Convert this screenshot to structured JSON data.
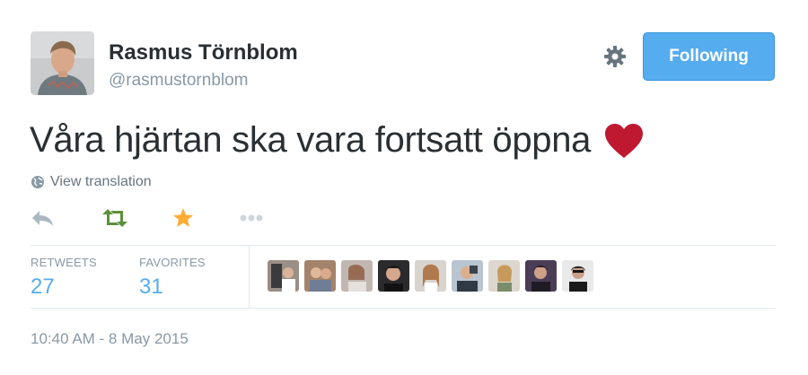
{
  "author": {
    "name": "Rasmus Törnblom",
    "handle": "@rasmustornblom"
  },
  "follow_button": {
    "label": "Following"
  },
  "tweet": {
    "text": "Våra hjärtan ska vara fortsatt öppna"
  },
  "translation": {
    "label": "View translation"
  },
  "actions": [
    {
      "icon": "reply-icon",
      "color": "#aab8c2"
    },
    {
      "icon": "retweet-icon",
      "color": "#5c913b"
    },
    {
      "icon": "favorite-star-icon",
      "color": "#ffac33"
    },
    {
      "icon": "more-dots-icon",
      "color": "#ccd6dd"
    }
  ],
  "stats": {
    "retweets_label": "RETWEETS",
    "retweets_count": "27",
    "favorites_label": "FAVORITES",
    "favorites_count": "31"
  },
  "favoriters_count_shown": 9,
  "timestamp": "10:40 AM - 8 May 2015",
  "colors": {
    "accent": "#55acee",
    "heart": "#be1931",
    "muted": "#8899a6",
    "text": "#292f33"
  }
}
